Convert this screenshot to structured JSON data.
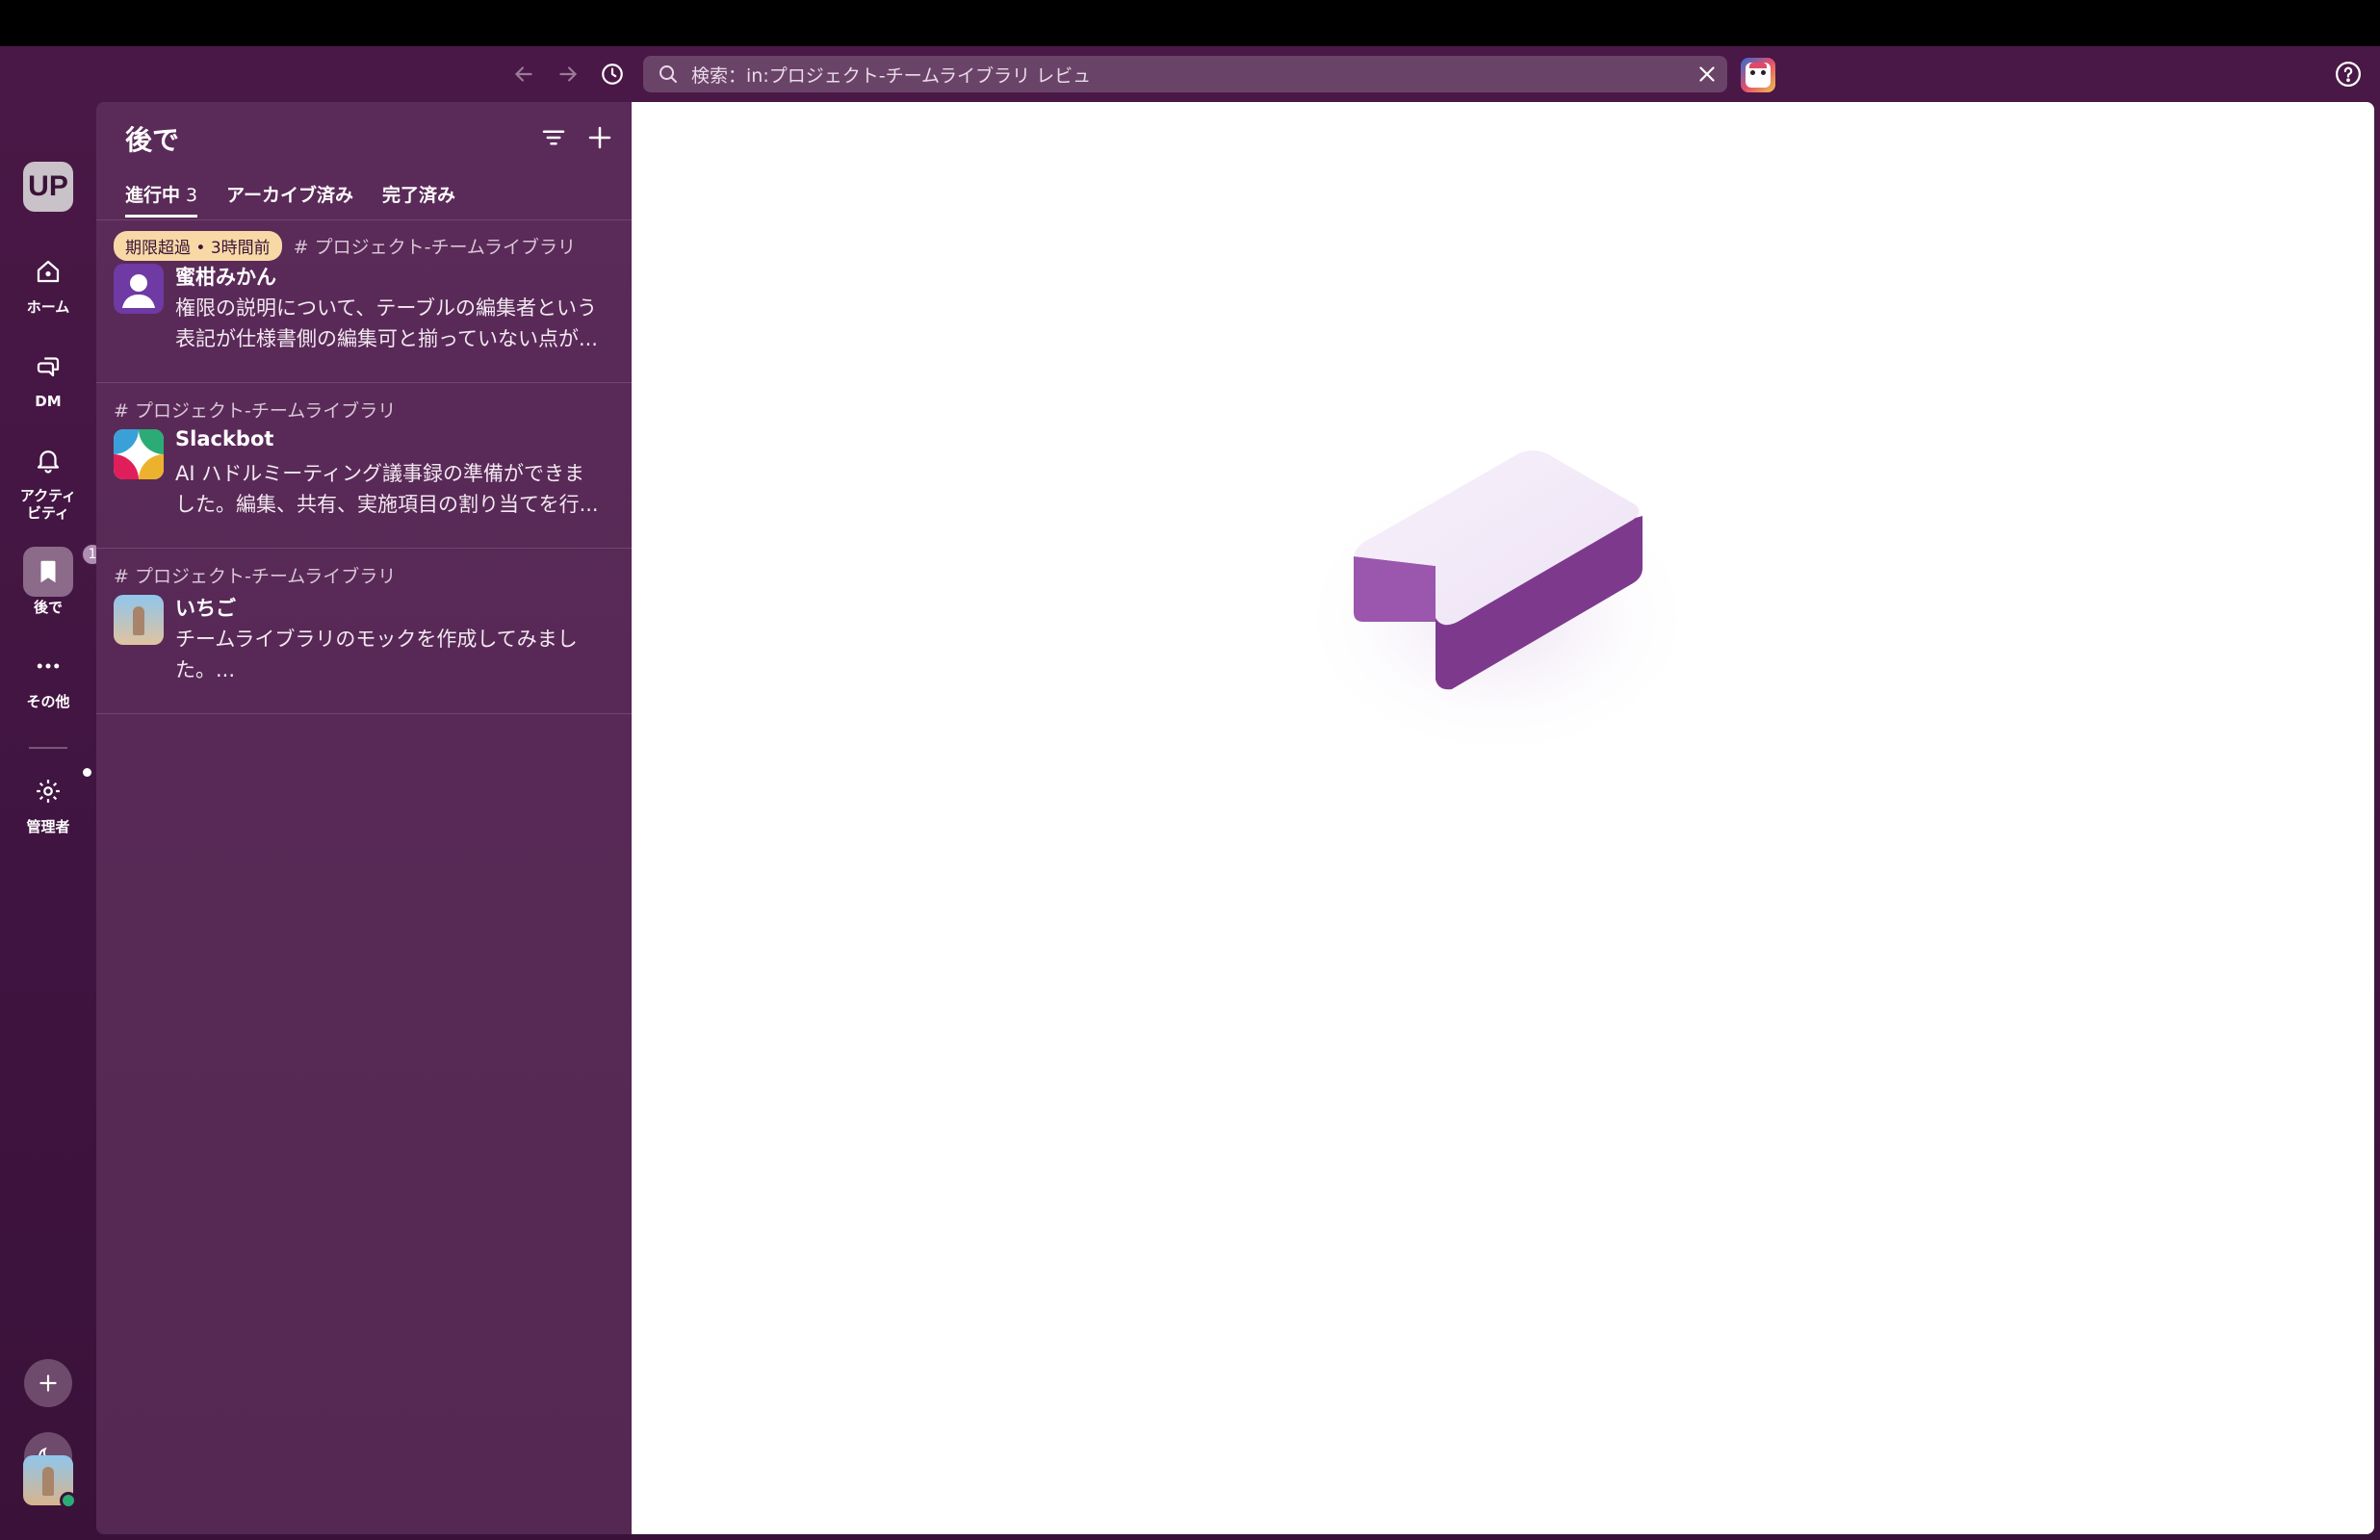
{
  "toolbar": {
    "search_text": "検索：in:プロジェクト-チームライブラリ レビュ"
  },
  "workspace": {
    "initials": "UP"
  },
  "rail": {
    "home": "ホーム",
    "dm": "DM",
    "activity_line1": "アクティ",
    "activity_line2": "ビティ",
    "later": "後で",
    "later_badge": "1",
    "more": "その他",
    "admin": "管理者"
  },
  "panel": {
    "title": "後で",
    "tabs": [
      {
        "label": "進行中",
        "count": "3"
      },
      {
        "label": "アーカイブ済み"
      },
      {
        "label": "完了済み"
      }
    ],
    "items": [
      {
        "overdue": "期限超過 • 3時間前",
        "channel": "# プロジェクト-チームライブラリ",
        "sender": "蜜柑みかん",
        "line1": "権限の説明について、テーブルの編集者という",
        "line2": "表記が仕様書側の編集可と揃っていない点が..."
      },
      {
        "channel": "# プロジェクト-チームライブラリ",
        "sender": "Slackbot",
        "line1": "AI ハドルミーティング議事録の準備ができま",
        "line2": "した。編集、共有、実施項目の割り当てを行..."
      },
      {
        "channel": "# プロジェクト-チームライブラリ",
        "sender": "いちご",
        "line1": "チームライブラリのモックを作成してみまし",
        "line2": "た。..."
      }
    ]
  },
  "colors": {
    "sidebar": "#4a1846",
    "panel": "#5a2a58",
    "overdue_badge": "#f8d9a6",
    "illustration_top": "#f2e9f6",
    "illustration_side": "#7d3a8c"
  }
}
